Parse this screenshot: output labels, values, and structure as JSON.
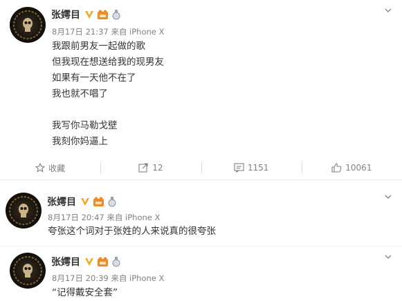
{
  "posts": [
    {
      "author": "张嫮目",
      "meta": "8月17日 21:37 来自 iPhone X",
      "lines": [
        "我跟前男友一起做的歌",
        "但我现在想送给我的现男友",
        "如果有一天他不在了",
        "我也就不唱了",
        "",
        "我写你马勒戈壁",
        "我刻你妈逼上"
      ]
    },
    {
      "author": "张嫮目",
      "meta": "8月17日 20:47 来自 iPhone X",
      "lines": [
        "夸张这个词对于张姓的人来说真的很夸张"
      ]
    },
    {
      "author": "张嫮目",
      "meta": "8月17日 20:39 来自 iPhone X",
      "lines": [
        "“记得戴安全套”"
      ]
    }
  ],
  "actions": {
    "favorite": "收藏",
    "repost": "12",
    "comment": "1151",
    "like": "10061"
  },
  "colors": {
    "verified": "#f5a623",
    "badge_orange": "#f08a24",
    "text_gray": "#808080"
  }
}
